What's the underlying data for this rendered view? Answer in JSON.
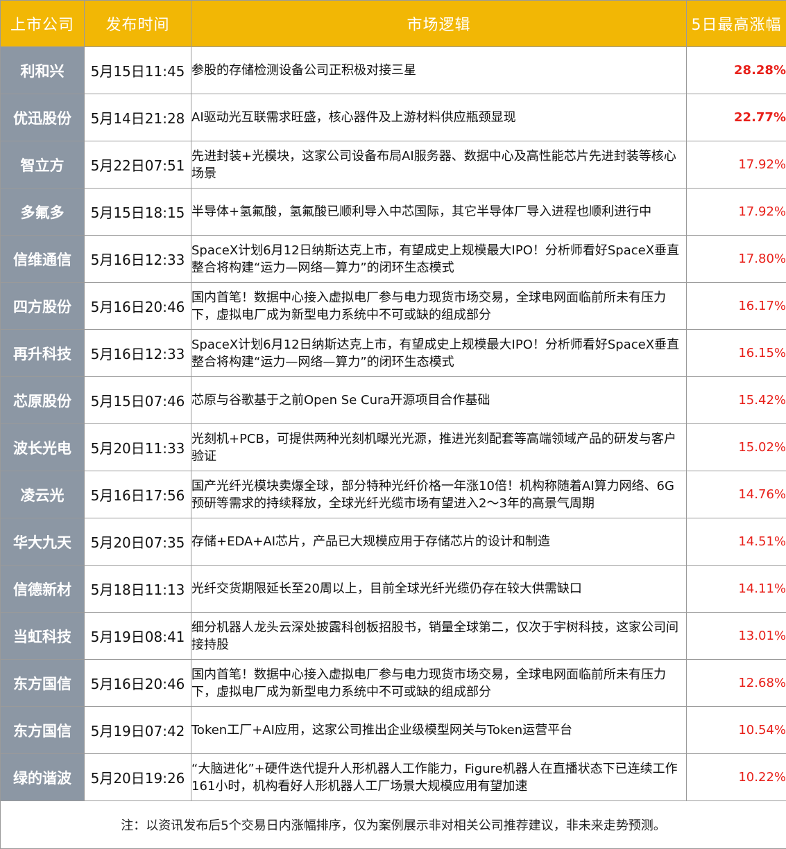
{
  "header": {
    "company": "上市公司",
    "time": "发布时间",
    "logic": "市场逻辑",
    "gain": "5日最高涨幅"
  },
  "rows": [
    {
      "company": "利和兴",
      "time": "5月15日11:45",
      "logic": "参股的存储检测设备公司正积极对接三星",
      "gain": "28.28%"
    },
    {
      "company": "优迅股份",
      "time": "5月14日21:28",
      "logic": "AI驱动光互联需求旺盛，核心器件及上游材料供应瓶颈显现",
      "gain": "22.77%"
    },
    {
      "company": "智立方",
      "time": "5月22日07:51",
      "logic": "先进封装+光模块，这家公司设备布局AI服务器、数据中心及高性能芯片先进封装等核心场景",
      "gain": "17.92%"
    },
    {
      "company": "多氟多",
      "time": "5月15日18:15",
      "logic": "半导体+氢氟酸，氢氟酸已顺利导入中芯国际，其它半导体厂导入进程也顺利进行中",
      "gain": "17.92%"
    },
    {
      "company": "信维通信",
      "time": "5月16日12:33",
      "logic": "SpaceX计划6月12日纳斯达克上市，有望成史上规模最大IPO！分析师看好SpaceX垂直整合将构建“运力—网络—算力”的闭环生态模式",
      "gain": "17.80%"
    },
    {
      "company": "四方股份",
      "time": "5月16日20:46",
      "logic": "国内首笔！数据中心接入虚拟电厂参与电力现货市场交易，全球电网面临前所未有压力下，虚拟电厂成为新型电力系统中不可或缺的组成部分",
      "gain": "16.17%"
    },
    {
      "company": "再升科技",
      "time": "5月16日12:33",
      "logic": "SpaceX计划6月12日纳斯达克上市，有望成史上规模最大IPO！分析师看好SpaceX垂直整合将构建“运力—网络—算力”的闭环生态模式",
      "gain": "16.15%"
    },
    {
      "company": "芯原股份",
      "time": "5月15日07:46",
      "logic": "芯原与谷歌基于之前Open Se Cura开源项目合作基础",
      "gain": "15.42%"
    },
    {
      "company": "波长光电",
      "time": "5月20日11:33",
      "logic": "光刻机+PCB，可提供两种光刻机曝光光源，推进光刻配套等高端领域产品的研发与客户验证",
      "gain": "15.02%"
    },
    {
      "company": "凌云光",
      "time": "5月16日17:56",
      "logic": "国产光纤光模块卖爆全球，部分特种光纤价格一年涨10倍！机构称随着AI算力网络、6G预研等需求的持续释放，全球光纤光缆市场有望进入2～3年的高景气周期",
      "gain": "14.76%"
    },
    {
      "company": "华大九天",
      "time": "5月20日07:35",
      "logic": "存储+EDA+AI芯片，产品已大规模应用于存储芯片的设计和制造",
      "gain": "14.51%"
    },
    {
      "company": "信德新材",
      "time": "5月18日11:13",
      "logic": "光纤交货期限延长至20周以上，目前全球光纤光缆仍存在较大供需缺口",
      "gain": "14.11%"
    },
    {
      "company": "当虹科技",
      "time": "5月19日08:41",
      "logic": "细分机器人龙头云深处披露科创板招股书，销量全球第二，仅次于宇树科技，这家公司间接持股",
      "gain": "13.01%"
    },
    {
      "company": "东方国信",
      "time": "5月16日20:46",
      "logic": "国内首笔！数据中心接入虚拟电厂参与电力现货市场交易，全球电网面临前所未有压力下，虚拟电厂成为新型电力系统中不可或缺的组成部分",
      "gain": "12.68%"
    },
    {
      "company": "东方国信",
      "time": "5月19日07:42",
      "logic": "Token工厂+AI应用，这家公司推出企业级模型网关与Token运营平台",
      "gain": "10.54%"
    },
    {
      "company": "绿的谐波",
      "time": "5月20日19:26",
      "logic": "“大脑进化”+硬件迭代提升人形机器人工作能力，Figure机器人在直播状态下已连续工作161小时，机构看好人形机器人工厂场景大规模应用有望加速",
      "gain": "10.22%"
    }
  ],
  "note": "注：以资讯发布后5个交易日内涨幅排序，仅为案例展示非对相关公司推荐建议，非未来走势预测。",
  "colors": {
    "header_bg": "#f2b705",
    "company_bg": "#8c97a4",
    "gain_text": "#e8201a"
  }
}
